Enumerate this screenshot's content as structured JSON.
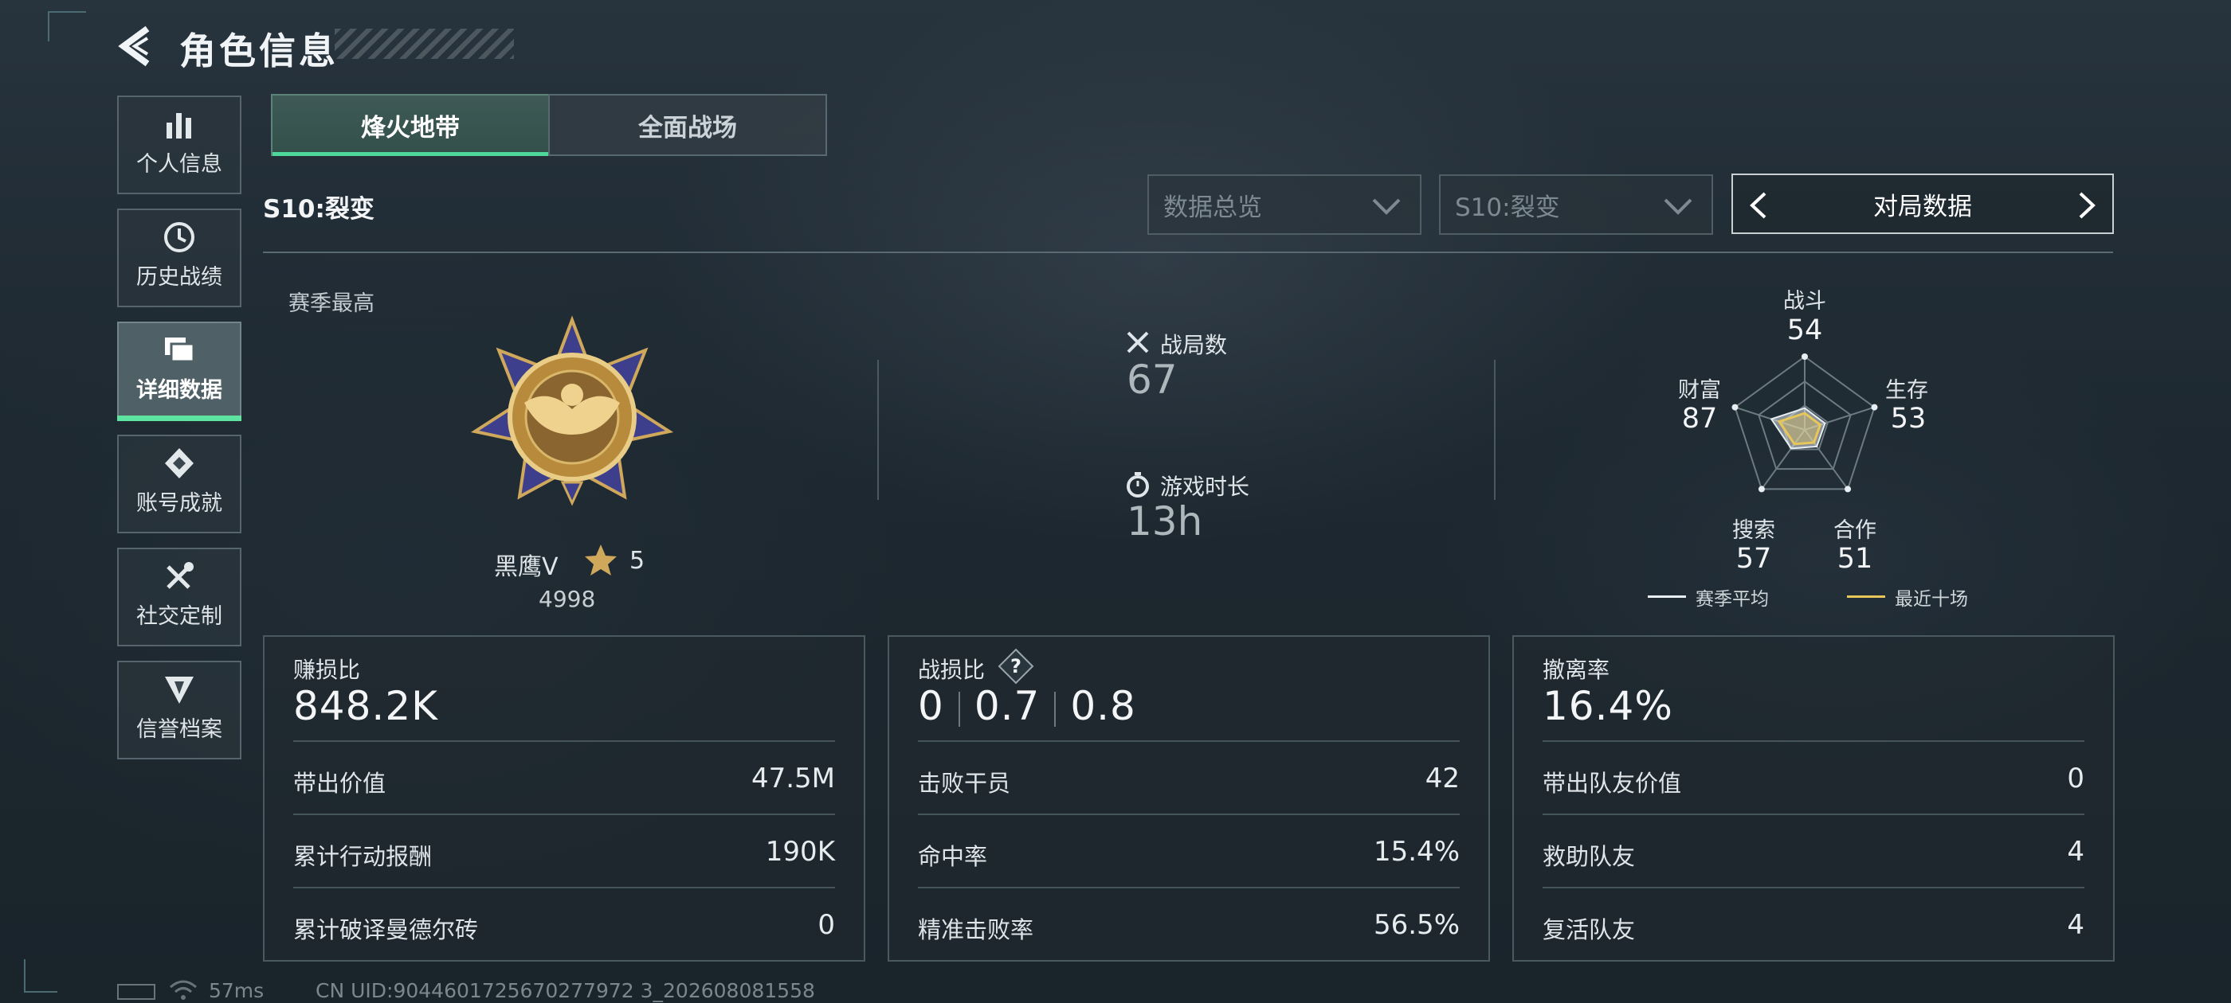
{
  "header": {
    "title": "角色信息"
  },
  "sidebar": {
    "items": [
      {
        "label": "个人信息",
        "icon": "bar-chart-icon"
      },
      {
        "label": "历史战绩",
        "icon": "history-icon"
      },
      {
        "label": "详细数据",
        "icon": "folder-icon",
        "active": true
      },
      {
        "label": "账号成就",
        "icon": "achievement-icon"
      },
      {
        "label": "社交定制",
        "icon": "tools-icon"
      },
      {
        "label": "信誉档案",
        "icon": "shield-icon"
      }
    ]
  },
  "tabs": [
    {
      "label": "烽火地带",
      "active": true
    },
    {
      "label": "全面战场"
    }
  ],
  "season_label": "S10:裂变",
  "filters": {
    "overview": "数据总览",
    "season": "S10:裂变",
    "pager": "对局数据"
  },
  "summary": {
    "season_best_label": "赛季最高",
    "rank_name": "黑鹰V",
    "rank_stars": "5",
    "rank_points": "4998",
    "matches_label": "战局数",
    "matches_value": "67",
    "playtime_label": "游戏时长",
    "playtime_value": "13h"
  },
  "radar": {
    "axes": [
      {
        "label": "战斗",
        "value": "54"
      },
      {
        "label": "生存",
        "value": "53"
      },
      {
        "label": "合作",
        "value": "51"
      },
      {
        "label": "搜索",
        "value": "57"
      },
      {
        "label": "财富",
        "value": "87"
      }
    ],
    "legend": [
      {
        "label": "赛季平均",
        "color": "#e8eef1"
      },
      {
        "label": "最近十场",
        "color": "#e7c65a"
      }
    ]
  },
  "cards": [
    {
      "title": "赚损比",
      "value": "848.2K",
      "rows": [
        {
          "label": "带出价值",
          "value": "47.5M"
        },
        {
          "label": "累计行动报酬",
          "value": "190K"
        },
        {
          "label": "累计破译曼德尔砖",
          "value": "0"
        }
      ]
    },
    {
      "title": "战损比",
      "values": [
        "0",
        "0.7",
        "0.8"
      ],
      "help": "?",
      "rows": [
        {
          "label": "击败干员",
          "value": "42"
        },
        {
          "label": "命中率",
          "value": "15.4%"
        },
        {
          "label": "精准击败率",
          "value": "56.5%"
        }
      ]
    },
    {
      "title": "撤离率",
      "value": "16.4%",
      "rows": [
        {
          "label": "带出队友价值",
          "value": "0"
        },
        {
          "label": "救助队友",
          "value": "4"
        },
        {
          "label": "复活队友",
          "value": "4"
        }
      ]
    }
  ],
  "footer": {
    "ping": "57ms",
    "uid": "CN UID:9044601725670277972 3_202608081558"
  },
  "colors": {
    "accent": "#4fd89b",
    "legend_recent": "#e7c65a"
  }
}
